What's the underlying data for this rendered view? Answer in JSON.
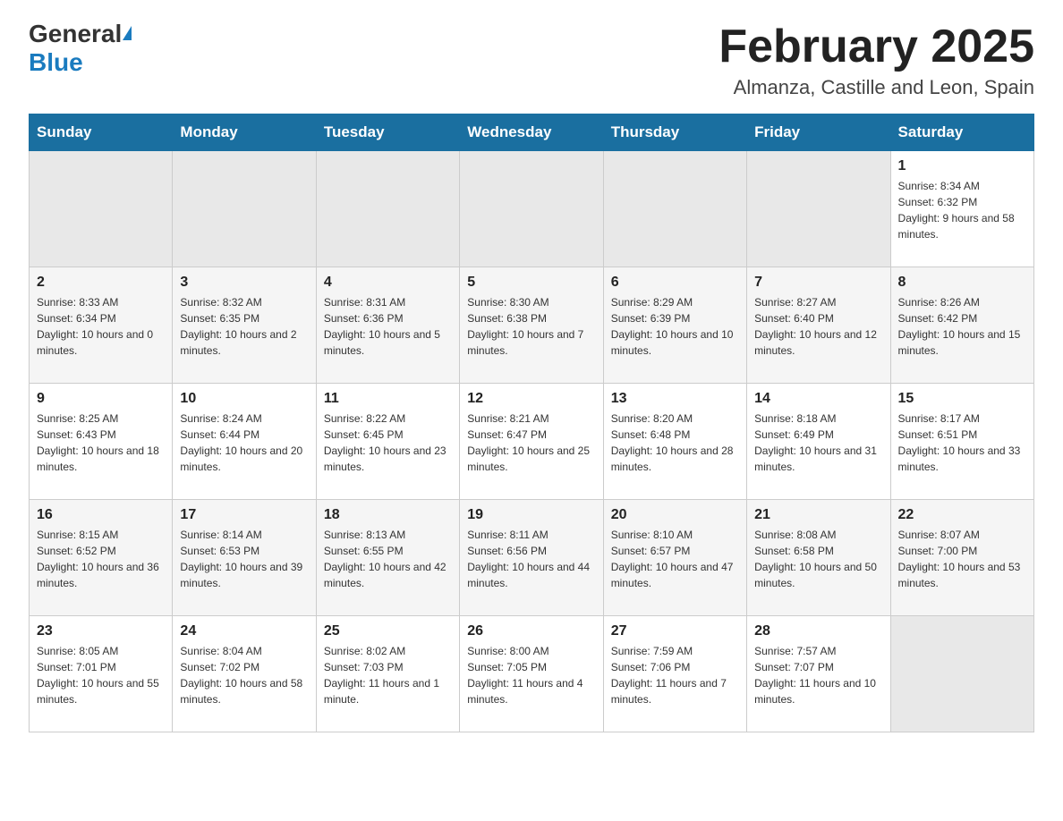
{
  "header": {
    "logo_general": "General",
    "logo_blue": "Blue",
    "month_title": "February 2025",
    "location": "Almanza, Castille and Leon, Spain"
  },
  "calendar": {
    "days_of_week": [
      "Sunday",
      "Monday",
      "Tuesday",
      "Wednesday",
      "Thursday",
      "Friday",
      "Saturday"
    ],
    "weeks": [
      {
        "row_class": "row-odd",
        "days": [
          {
            "number": "",
            "info": "",
            "empty": true
          },
          {
            "number": "",
            "info": "",
            "empty": true
          },
          {
            "number": "",
            "info": "",
            "empty": true
          },
          {
            "number": "",
            "info": "",
            "empty": true
          },
          {
            "number": "",
            "info": "",
            "empty": true
          },
          {
            "number": "",
            "info": "",
            "empty": true
          },
          {
            "number": "1",
            "info": "Sunrise: 8:34 AM\nSunset: 6:32 PM\nDaylight: 9 hours and 58 minutes.",
            "empty": false
          }
        ]
      },
      {
        "row_class": "row-even",
        "days": [
          {
            "number": "2",
            "info": "Sunrise: 8:33 AM\nSunset: 6:34 PM\nDaylight: 10 hours and 0 minutes.",
            "empty": false
          },
          {
            "number": "3",
            "info": "Sunrise: 8:32 AM\nSunset: 6:35 PM\nDaylight: 10 hours and 2 minutes.",
            "empty": false
          },
          {
            "number": "4",
            "info": "Sunrise: 8:31 AM\nSunset: 6:36 PM\nDaylight: 10 hours and 5 minutes.",
            "empty": false
          },
          {
            "number": "5",
            "info": "Sunrise: 8:30 AM\nSunset: 6:38 PM\nDaylight: 10 hours and 7 minutes.",
            "empty": false
          },
          {
            "number": "6",
            "info": "Sunrise: 8:29 AM\nSunset: 6:39 PM\nDaylight: 10 hours and 10 minutes.",
            "empty": false
          },
          {
            "number": "7",
            "info": "Sunrise: 8:27 AM\nSunset: 6:40 PM\nDaylight: 10 hours and 12 minutes.",
            "empty": false
          },
          {
            "number": "8",
            "info": "Sunrise: 8:26 AM\nSunset: 6:42 PM\nDaylight: 10 hours and 15 minutes.",
            "empty": false
          }
        ]
      },
      {
        "row_class": "row-odd",
        "days": [
          {
            "number": "9",
            "info": "Sunrise: 8:25 AM\nSunset: 6:43 PM\nDaylight: 10 hours and 18 minutes.",
            "empty": false
          },
          {
            "number": "10",
            "info": "Sunrise: 8:24 AM\nSunset: 6:44 PM\nDaylight: 10 hours and 20 minutes.",
            "empty": false
          },
          {
            "number": "11",
            "info": "Sunrise: 8:22 AM\nSunset: 6:45 PM\nDaylight: 10 hours and 23 minutes.",
            "empty": false
          },
          {
            "number": "12",
            "info": "Sunrise: 8:21 AM\nSunset: 6:47 PM\nDaylight: 10 hours and 25 minutes.",
            "empty": false
          },
          {
            "number": "13",
            "info": "Sunrise: 8:20 AM\nSunset: 6:48 PM\nDaylight: 10 hours and 28 minutes.",
            "empty": false
          },
          {
            "number": "14",
            "info": "Sunrise: 8:18 AM\nSunset: 6:49 PM\nDaylight: 10 hours and 31 minutes.",
            "empty": false
          },
          {
            "number": "15",
            "info": "Sunrise: 8:17 AM\nSunset: 6:51 PM\nDaylight: 10 hours and 33 minutes.",
            "empty": false
          }
        ]
      },
      {
        "row_class": "row-even",
        "days": [
          {
            "number": "16",
            "info": "Sunrise: 8:15 AM\nSunset: 6:52 PM\nDaylight: 10 hours and 36 minutes.",
            "empty": false
          },
          {
            "number": "17",
            "info": "Sunrise: 8:14 AM\nSunset: 6:53 PM\nDaylight: 10 hours and 39 minutes.",
            "empty": false
          },
          {
            "number": "18",
            "info": "Sunrise: 8:13 AM\nSunset: 6:55 PM\nDaylight: 10 hours and 42 minutes.",
            "empty": false
          },
          {
            "number": "19",
            "info": "Sunrise: 8:11 AM\nSunset: 6:56 PM\nDaylight: 10 hours and 44 minutes.",
            "empty": false
          },
          {
            "number": "20",
            "info": "Sunrise: 8:10 AM\nSunset: 6:57 PM\nDaylight: 10 hours and 47 minutes.",
            "empty": false
          },
          {
            "number": "21",
            "info": "Sunrise: 8:08 AM\nSunset: 6:58 PM\nDaylight: 10 hours and 50 minutes.",
            "empty": false
          },
          {
            "number": "22",
            "info": "Sunrise: 8:07 AM\nSunset: 7:00 PM\nDaylight: 10 hours and 53 minutes.",
            "empty": false
          }
        ]
      },
      {
        "row_class": "row-odd",
        "days": [
          {
            "number": "23",
            "info": "Sunrise: 8:05 AM\nSunset: 7:01 PM\nDaylight: 10 hours and 55 minutes.",
            "empty": false
          },
          {
            "number": "24",
            "info": "Sunrise: 8:04 AM\nSunset: 7:02 PM\nDaylight: 10 hours and 58 minutes.",
            "empty": false
          },
          {
            "number": "25",
            "info": "Sunrise: 8:02 AM\nSunset: 7:03 PM\nDaylight: 11 hours and 1 minute.",
            "empty": false
          },
          {
            "number": "26",
            "info": "Sunrise: 8:00 AM\nSunset: 7:05 PM\nDaylight: 11 hours and 4 minutes.",
            "empty": false
          },
          {
            "number": "27",
            "info": "Sunrise: 7:59 AM\nSunset: 7:06 PM\nDaylight: 11 hours and 7 minutes.",
            "empty": false
          },
          {
            "number": "28",
            "info": "Sunrise: 7:57 AM\nSunset: 7:07 PM\nDaylight: 11 hours and 10 minutes.",
            "empty": false
          },
          {
            "number": "",
            "info": "",
            "empty": true
          }
        ]
      }
    ]
  }
}
